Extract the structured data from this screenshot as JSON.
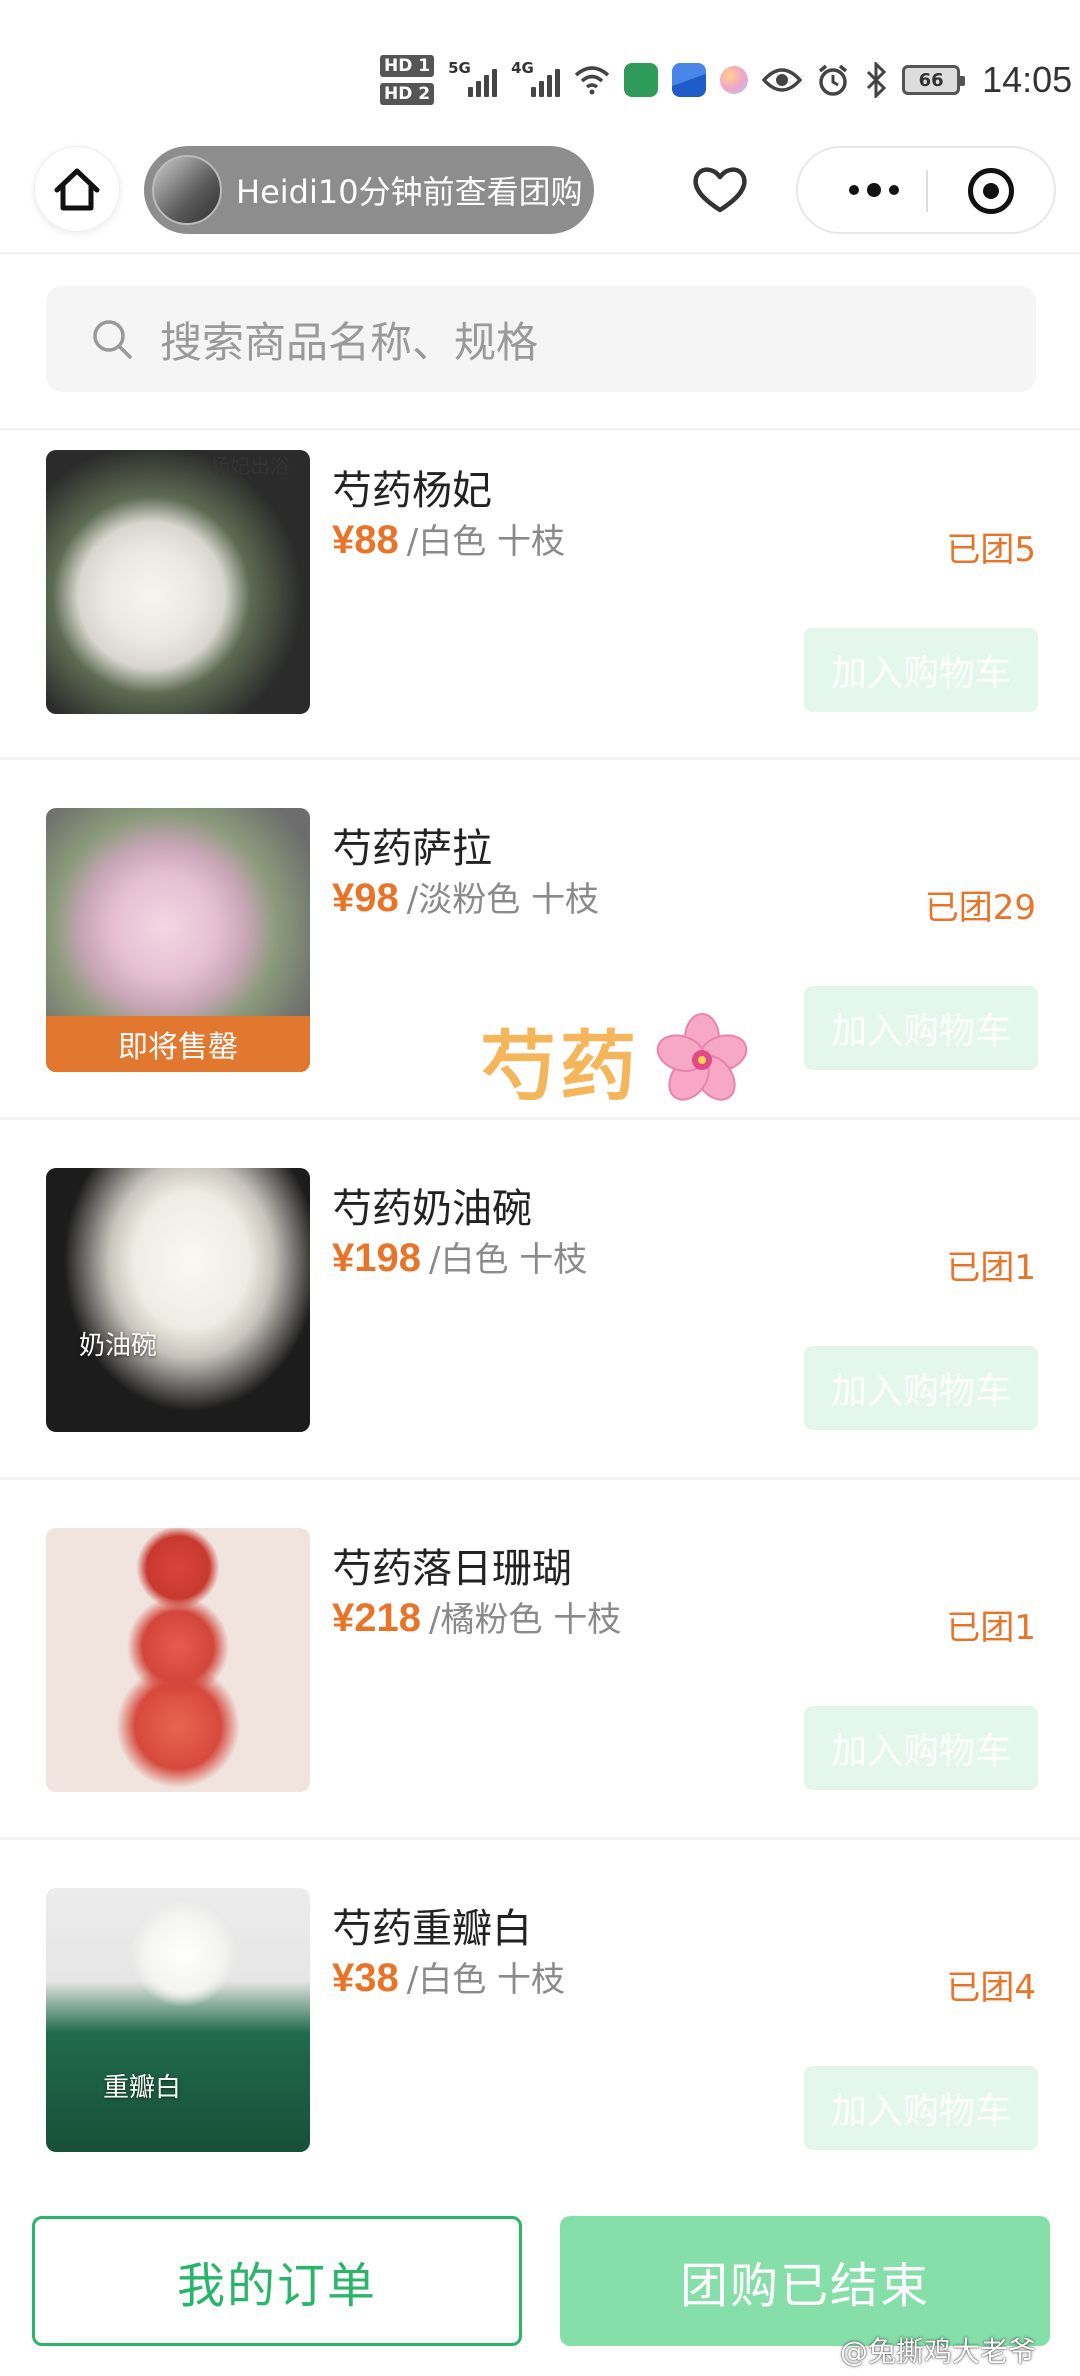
{
  "status_bar": {
    "hd1": "HD 1",
    "hd2": "HD 2",
    "net1": "5G",
    "net2": "4G",
    "battery": "66",
    "time": "14:05"
  },
  "nav": {
    "notification": "Heidi10分钟前查看团购"
  },
  "search": {
    "placeholder": "搜索商品名称、规格"
  },
  "products": [
    {
      "name": "芍药杨妃",
      "price": "¥88",
      "spec": "/白色 十枝",
      "sold": "已团5",
      "cart": "加入购物车",
      "thumb_label": "杨妃出浴"
    },
    {
      "name": "芍药萨拉",
      "price": "¥98",
      "spec": "/淡粉色 十枝",
      "sold": "已团29",
      "cart": "加入购物车",
      "badge": "即将售罄"
    },
    {
      "name": "芍药奶油碗",
      "price": "¥198",
      "spec": "/白色 十枝",
      "sold": "已团1",
      "cart": "加入购物车",
      "thumb_label": "奶油碗"
    },
    {
      "name": "芍药落日珊瑚",
      "price": "¥218",
      "spec": "/橘粉色 十枝",
      "sold": "已团1",
      "cart": "加入购物车"
    },
    {
      "name": "芍药重瓣白",
      "price": "¥38",
      "spec": "/白色 十枝",
      "sold": "已团4",
      "cart": "加入购物车",
      "thumb_label": "重瓣白"
    }
  ],
  "sticker": {
    "text": "芍药"
  },
  "bottom": {
    "orders": "我的订单",
    "ended": "团购已结束"
  },
  "watermark": "@兔撕鸡大老爷",
  "colors": {
    "accent_green": "#2bb56a",
    "light_green": "#86dfa9",
    "price_orange": "#e8742a"
  },
  "icons": [
    "home-icon",
    "heart-icon",
    "more-dots-icon",
    "close-mini-program-icon",
    "search-icon"
  ]
}
